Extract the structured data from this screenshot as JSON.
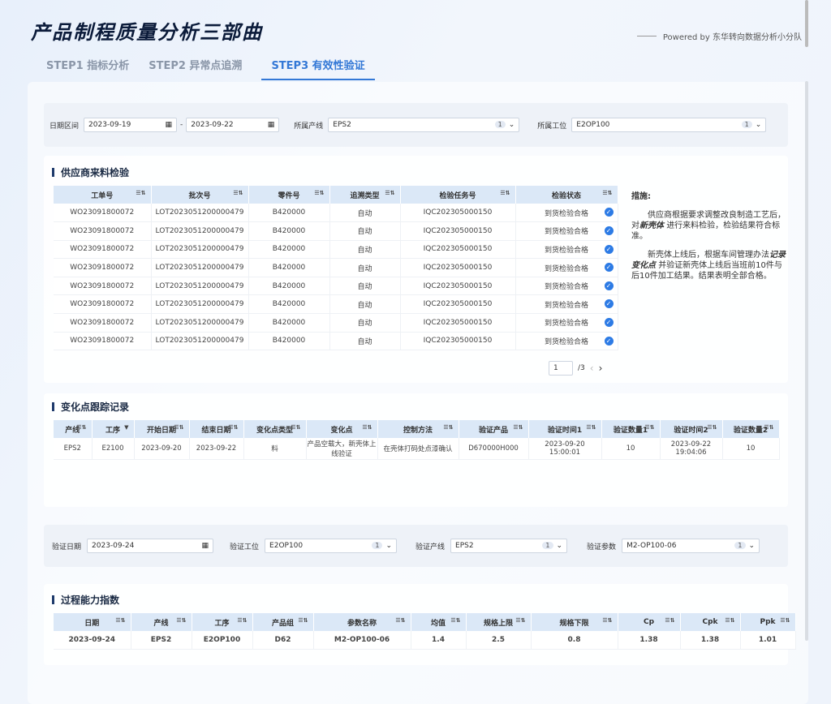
{
  "title": "产品制程质量分析三部曲",
  "powered": "Powered by 东华转向数据分析小分队",
  "tabs": [
    "STEP1 指标分析",
    "STEP2 异常点追溯",
    "STEP3 有效性验证"
  ],
  "filter1": {
    "date_label": "日期区间",
    "date_from": "2023-09-19",
    "date_to": "2023-09-22",
    "sep": "-",
    "line_label": "所属产线",
    "line_value": "EPS2",
    "line_count": "1",
    "station_label": "所属工位",
    "station_value": "E2OP100",
    "station_count": "1"
  },
  "supplier": {
    "title": "供应商来料检验",
    "headers": [
      "工单号",
      "批次号",
      "零件号",
      "追溯类型",
      "检验任务号",
      "检验状态"
    ],
    "rows": [
      [
        "WO23091800072",
        "LOT2023051200000479",
        "B420000",
        "自动",
        "IQC202305000150",
        "到货检验合格"
      ],
      [
        "WO23091800072",
        "LOT2023051200000479",
        "B420000",
        "自动",
        "IQC202305000150",
        "到货检验合格"
      ],
      [
        "WO23091800072",
        "LOT2023051200000479",
        "B420000",
        "自动",
        "IQC202305000150",
        "到货检验合格"
      ],
      [
        "WO23091800072",
        "LOT2023051200000479",
        "B420000",
        "自动",
        "IQC202305000150",
        "到货检验合格"
      ],
      [
        "WO23091800072",
        "LOT2023051200000479",
        "B420000",
        "自动",
        "IQC202305000150",
        "到货检验合格"
      ],
      [
        "WO23091800072",
        "LOT2023051200000479",
        "B420000",
        "自动",
        "IQC202305000150",
        "到货检验合格"
      ],
      [
        "WO23091800072",
        "LOT2023051200000479",
        "B420000",
        "自动",
        "IQC202305000150",
        "到货检验合格"
      ],
      [
        "WO23091800072",
        "LOT2023051200000479",
        "B420000",
        "自动",
        "IQC202305000150",
        "到货检验合格"
      ]
    ],
    "page": "1",
    "total": "/3"
  },
  "note": {
    "heading": "措施:",
    "p1a": "供应商根据要求调整改良制造工艺后，对",
    "p1b": "新壳体",
    "p1c": "进行来料检验，检验结果符合标准。",
    "p2a": "新壳体上线后，根据车间管理办法",
    "p2b": "记录变化点",
    "p2c": "并验证新壳体上线后当班前10件与后10件加工结果。结果表明全部合格。"
  },
  "change": {
    "title": "变化点跟踪记录",
    "headers": [
      "产线",
      "工序",
      "开始日期",
      "结束日期",
      "变化点类型",
      "变化点",
      "控制方法",
      "验证产品",
      "验证时间1",
      "验证数量1",
      "验证时间2",
      "验证数量2"
    ],
    "row": [
      "EPS2",
      "E2100",
      "2023-09-20",
      "2023-09-22",
      "料",
      "产品空载大，新壳体上线验证",
      "在壳体打码处点漆确认",
      "D670000H000",
      "2023-09-20 15:00:01",
      "10",
      "2023-09-22 19:04:06",
      "10"
    ]
  },
  "filter2": {
    "date_label": "验证日期",
    "date": "2023-09-24",
    "station_label": "验证工位",
    "station": "E2OP100",
    "station_count": "1",
    "line_label": "验证产线",
    "line": "EPS2",
    "line_count": "1",
    "param_label": "验证参数",
    "param": "M2-OP100-06",
    "param_count": "1"
  },
  "capability": {
    "title": "过程能力指数",
    "headers": [
      "日期",
      "产线",
      "工序",
      "产品组",
      "参数名称",
      "均值",
      "规格上限",
      "规格下限",
      "Cp",
      "Cpk",
      "Ppk"
    ],
    "row": [
      "2023-09-24",
      "EPS2",
      "E2OP100",
      "D62",
      "M2-OP100-06",
      "1.4",
      "2.5",
      "0.8",
      "1.38",
      "1.38",
      "1.01"
    ]
  }
}
